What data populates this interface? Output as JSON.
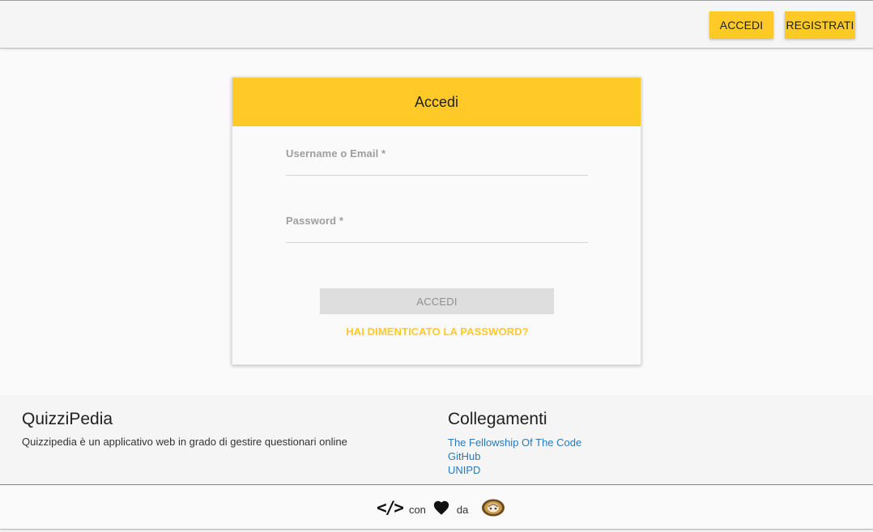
{
  "topbar": {
    "login_label": "ACCEDI",
    "register_label": "REGISTRATI"
  },
  "login_card": {
    "title": "Accedi",
    "username_label": "Username o Email *",
    "password_label": "Password *",
    "submit_label": "ACCEDI",
    "forgot_label": "HAI DIMENTICATO LA PASSWORD?"
  },
  "footer": {
    "about_title": "QuizziPedia",
    "about_text": "Quizzipedia è un applicativo web in grado di gestire questionari online",
    "links_title": "Collegamenti",
    "links": [
      {
        "label": "The Fellowship Of The Code"
      },
      {
        "label": "GitHub"
      },
      {
        "label": "UNIPD"
      }
    ]
  },
  "credits": {
    "code_glyph": "</>",
    "con": "con",
    "da": "da",
    "heart_icon": "heart-icon",
    "avatar_icon": "team-logo-icon"
  },
  "colors": {
    "accent": "#ffca28",
    "link": "#2a7ab8",
    "disabled_button": "#dedede"
  }
}
